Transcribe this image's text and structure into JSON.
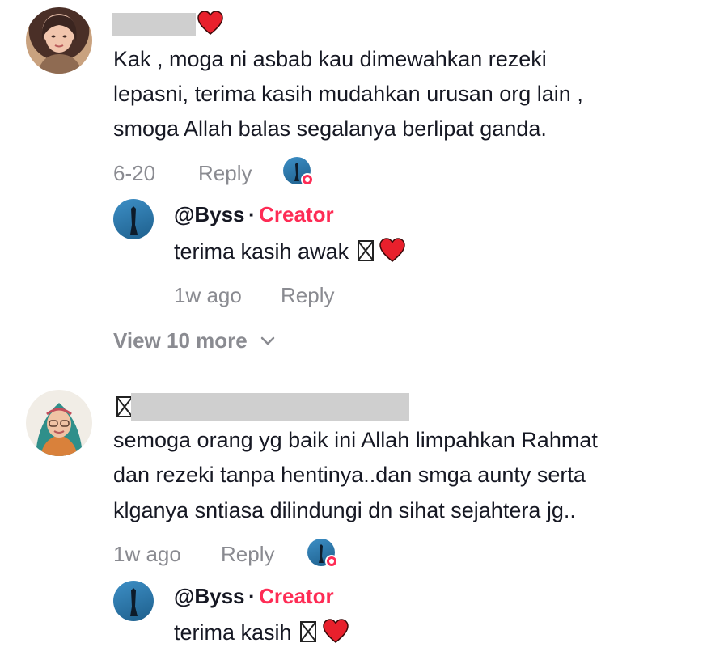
{
  "comments": [
    {
      "text_lines": [
        "Kak , moga ni asbab kau dimewahkan rezeki",
        "lepasni, terima kasih mudahkan urusan org lain ,",
        "smoga Allah balas segalanya berlipat ganda."
      ],
      "date": "6-20",
      "reply_label": "Reply",
      "reply": {
        "username": "@Byss",
        "separator": "·",
        "badge": "Creator",
        "text": "terima kasih awak",
        "date": "1w ago",
        "reply_label": "Reply"
      },
      "view_more": "View 10 more"
    },
    {
      "text_lines": [
        "semoga orang yg baik ini Allah limpahkan Rahmat",
        "dan rezeki tanpa hentinya..dan smga aunty serta",
        "klganya sntiasa dilindungi dn sihat sejahtera jg.."
      ],
      "date": "1w ago",
      "reply_label": "Reply",
      "reply": {
        "username": "@Byss",
        "separator": "·",
        "badge": "Creator",
        "text": "terima kasih",
        "date": "",
        "reply_label": ""
      }
    }
  ],
  "colors": {
    "accent": "#fe2c55",
    "meta": "#8a8b91",
    "text": "#161823",
    "heart": "#e8202c"
  }
}
